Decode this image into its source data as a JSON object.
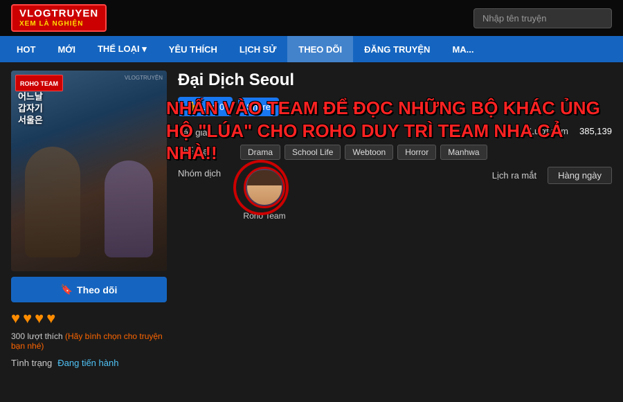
{
  "header": {
    "logo_top": "VLOGTRUYEN",
    "logo_bottom": "XEM LÀ NGHIỆN",
    "search_placeholder": "Nhập tên truyện"
  },
  "nav": {
    "items": [
      {
        "label": "HOT",
        "active": false
      },
      {
        "label": "MỚI",
        "active": false
      },
      {
        "label": "THỂ LOẠI ▾",
        "active": false
      },
      {
        "label": "YÊU THÍCH",
        "active": false
      },
      {
        "label": "LỊCH SỬ",
        "active": false
      },
      {
        "label": "THEO DÕI",
        "active": true
      },
      {
        "label": "ĐĂNG TRUYỆN",
        "active": false
      },
      {
        "label": "MA...",
        "active": false
      }
    ]
  },
  "manga": {
    "title": "Đại Dịch Seoul",
    "like_count": "0",
    "like_label": "Like",
    "share_label": "Share",
    "overlay_text_line1": "NHẤN VÀO TEAM ĐỂ ĐỌC NHỮNG BỘ KHÁC ỦNG",
    "overlay_text_line2": "HỘ \"LÚA\" CHO ROHO DUY TRÌ TEAM NHA CẢ NHÀ!!",
    "author_label": "Tác giả",
    "author_value": "",
    "genre_label": "Thể loại",
    "genres": [
      "Drama",
      "School Life",
      "Webtoon",
      "Horror",
      "Manhwa"
    ],
    "group_label": "Nhóm dịch",
    "group_name": "Roho Team",
    "views_label": "Lượt xem",
    "views_value": "385,139",
    "schedule_label": "Lịch ra mắt",
    "schedule_value": "Hàng ngày",
    "follow_label": "Theo dõi",
    "hearts_count": 4,
    "likes_count": "300",
    "likes_text": "lượt thích",
    "rate_prompt": "(Hãy bình chọn cho truyện bạn nhé)",
    "status_label": "Tình trạng",
    "status_value": "Đang tiến hành",
    "cover_team": "ROHO TEAM",
    "cover_watermark": "VLOGTRUYỆN",
    "cover_korean": "어느날갑자기서울은"
  }
}
